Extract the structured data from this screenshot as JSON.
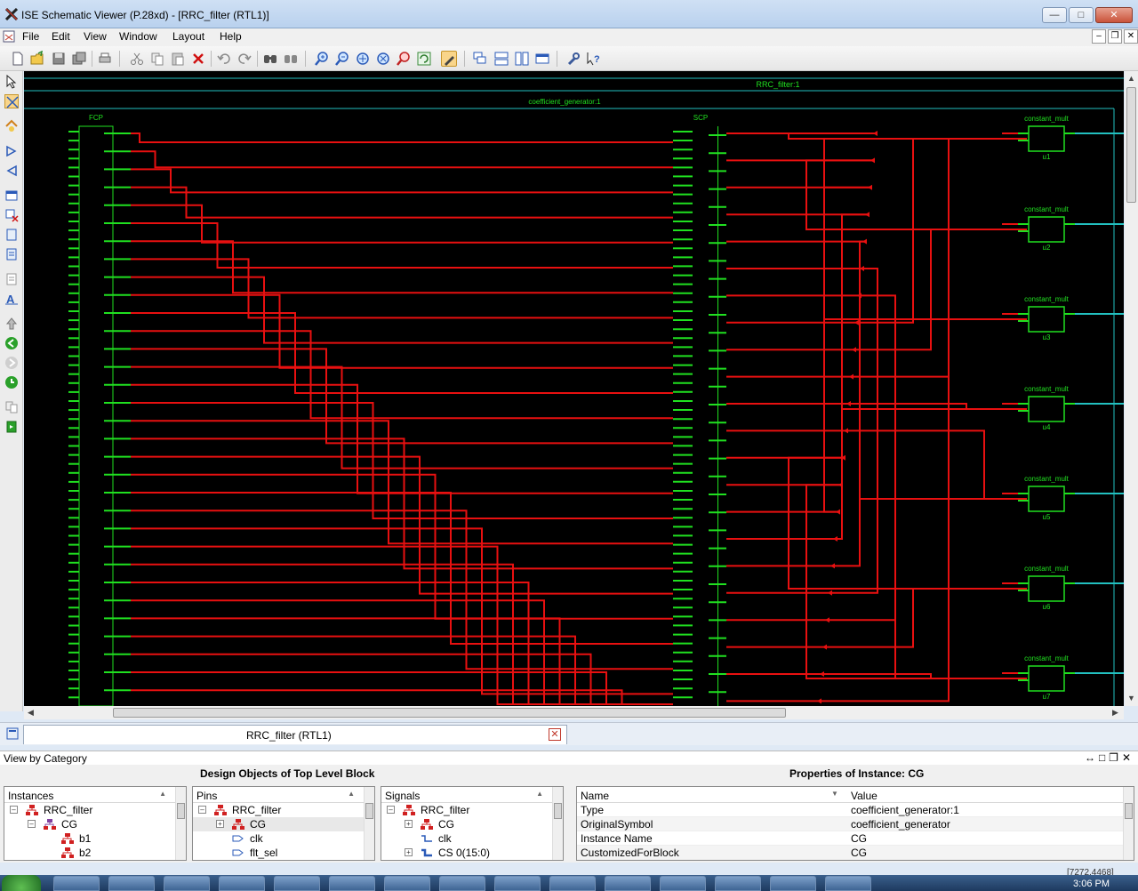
{
  "window": {
    "title": "ISE Schematic Viewer (P.28xd) - [RRC_filter (RTL1)]"
  },
  "menu": [
    "File",
    "Edit",
    "View",
    "Window",
    "Layout",
    "Help"
  ],
  "toolbar": [
    "new-icon",
    "open-icon",
    "save-icon",
    "save-all-icon",
    "print-icon",
    "cut-icon",
    "copy-icon",
    "paste-icon",
    "delete-icon",
    "undo-icon",
    "redo-icon",
    "find-icon",
    "find-next-icon",
    "zoom-in-icon",
    "zoom-out-icon",
    "zoom-full-icon",
    "zoom-fit-icon",
    "zoom-select-icon",
    "refresh-icon",
    "select-mode-icon",
    "cascade-icon",
    "tile-horizontal-icon",
    "tile-vertical-icon",
    "arrange-icon",
    "options-icon",
    "help-context-icon"
  ],
  "schematic": {
    "top_label": "RRC_filter:1",
    "sub_label": "coefficient_generator:1",
    "fcp_label": "FCP",
    "scp_label": "SCP",
    "mult_type": "constant_mult",
    "units": [
      "u1",
      "u2",
      "u3",
      "u4",
      "u5",
      "u6",
      "u7"
    ],
    "colors": {
      "background": "#000000",
      "wire": "#e81010",
      "component": "#20e020",
      "frame": "#22c0c0"
    }
  },
  "document_tab": {
    "label": "RRC_filter (RTL1)"
  },
  "panel": {
    "view_label": "View by Category",
    "design_objects_title": "Design Objects of Top Level Block",
    "properties_title": "Properties of Instance: CG",
    "instances": {
      "header": "Instances",
      "rows": [
        "RRC_filter",
        "CG",
        "b1",
        "b2"
      ]
    },
    "pins": {
      "header": "Pins",
      "rows": [
        "RRC_filter",
        "CG",
        "clk",
        "flt_sel"
      ]
    },
    "signals": {
      "header": "Signals",
      "rows": [
        "RRC_filter",
        "CG",
        "clk",
        "CS 0(15:0)"
      ]
    },
    "properties": {
      "name_header": "Name",
      "value_header": "Value",
      "rows": [
        {
          "name": "Type",
          "value": "coefficient_generator:1"
        },
        {
          "name": "OriginalSymbol",
          "value": "coefficient_generator"
        },
        {
          "name": "Instance Name",
          "value": "CG"
        },
        {
          "name": "CustomizedForBlock",
          "value": "CG"
        }
      ]
    }
  },
  "status": {
    "coordinates": "[7272,4468]"
  },
  "taskbar": {
    "clock": "3:06 PM"
  }
}
